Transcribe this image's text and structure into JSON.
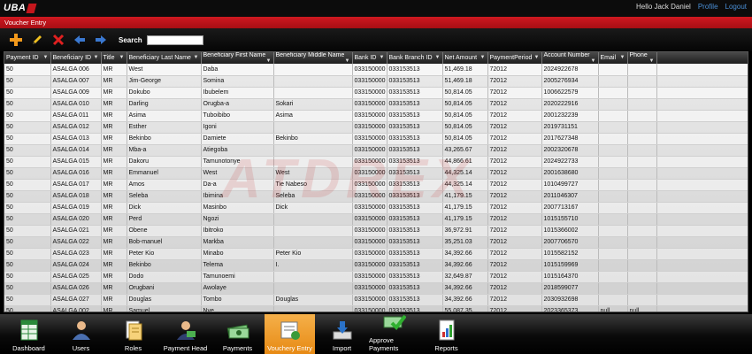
{
  "topbar": {
    "logo": "UBA",
    "greeting": "Hello Jack Daniel",
    "profile": "Profile",
    "logout": "Logout"
  },
  "titlebar": {
    "title": "Voucher Entry"
  },
  "toolbar": {
    "search_label": "Search",
    "search_value": ""
  },
  "watermark": "ATDREX",
  "table": {
    "columns": [
      "Payment ID",
      "Beneficiary ID",
      "Title",
      "Beneficiary Last Name",
      "Beneficiary First Name",
      "Beneficiary Middle Name",
      "Bank ID",
      "Bank Branch ID",
      "Net Amount",
      "PaymentPeriod",
      "Account Number",
      "Email",
      "Phone"
    ],
    "rows": [
      [
        "50",
        "ASALGA 006",
        "MR",
        "West",
        "Daba",
        "",
        "033150000",
        "033153513",
        "51,469.18",
        "72012",
        "2024922678",
        "",
        ""
      ],
      [
        "50",
        "ASALGA 007",
        "MR",
        "Jim-George",
        "Somina",
        "",
        "033150000",
        "033153513",
        "51,469.18",
        "72012",
        "2005276934",
        "",
        ""
      ],
      [
        "50",
        "ASALGA 009",
        "MR",
        "Dokubo",
        "Ibubelem",
        "",
        "033150000",
        "033153513",
        "50,814.05",
        "72012",
        "1006622579",
        "",
        ""
      ],
      [
        "50",
        "ASALGA 010",
        "MR",
        "Darling",
        "Orugba-a",
        "Sokari",
        "033150000",
        "033153513",
        "50,814.05",
        "72012",
        "2020222916",
        "",
        ""
      ],
      [
        "50",
        "ASALGA 011",
        "MR",
        "Asima",
        "Tuboibibo",
        "Asima",
        "033150000",
        "033153513",
        "50,814.05",
        "72012",
        "2001232239",
        "",
        ""
      ],
      [
        "50",
        "ASALGA 012",
        "MR",
        "Esther",
        "Igoni",
        "",
        "033150000",
        "033153513",
        "50,814.05",
        "72012",
        "2019731151",
        "",
        ""
      ],
      [
        "50",
        "ASALGA 013",
        "MR",
        "Bekinbo",
        "Damiete",
        "Bekinbo",
        "033150000",
        "033153513",
        "50,814.05",
        "72012",
        "2017627348",
        "",
        ""
      ],
      [
        "50",
        "ASALGA 014",
        "MR",
        "Mba-a",
        "Atiegoba",
        "",
        "033150000",
        "033153513",
        "43,265.67",
        "72012",
        "2002320678",
        "",
        ""
      ],
      [
        "50",
        "ASALGA 015",
        "MR",
        "Dakoru",
        "Tamunotonye",
        "",
        "033150000",
        "033153513",
        "44,866.61",
        "72012",
        "2024922733",
        "",
        ""
      ],
      [
        "50",
        "ASALGA 016",
        "MR",
        "Emmanuel",
        "West",
        "West",
        "033150000",
        "033153513",
        "44,325.14",
        "72012",
        "2001638680",
        "",
        ""
      ],
      [
        "50",
        "ASALGA 017",
        "MR",
        "Amos",
        "Da-a",
        "Tie Nabeso",
        "033150000",
        "033153513",
        "44,325.14",
        "72012",
        "1010499727",
        "",
        ""
      ],
      [
        "50",
        "ASALGA 018",
        "MR",
        "Seleba",
        "Ibimina",
        "Seleba",
        "033150000",
        "033153513",
        "41,179.15",
        "72012",
        "2011046307",
        "",
        ""
      ],
      [
        "50",
        "ASALGA 019",
        "MR",
        "Dick",
        "Masinbo",
        "Dick",
        "033150000",
        "033153513",
        "41,179.15",
        "72012",
        "2007713167",
        "",
        ""
      ],
      [
        "50",
        "ASALGA 020",
        "MR",
        "Perd",
        "Ngozi",
        "",
        "033150000",
        "033153513",
        "41,179.15",
        "72012",
        "1015155710",
        "",
        ""
      ],
      [
        "50",
        "ASALGA 021",
        "MR",
        "Obene",
        "Ibitroko",
        "",
        "033150000",
        "033153513",
        "36,972.91",
        "72012",
        "1015366002",
        "",
        ""
      ],
      [
        "50",
        "ASALGA 022",
        "MR",
        "Bob-manuel",
        "Markba",
        "",
        "033150000",
        "033153513",
        "35,251.03",
        "72012",
        "2007706570",
        "",
        ""
      ],
      [
        "50",
        "ASALGA 023",
        "MR",
        "Peter Kio",
        "Minabo",
        "Peter Kio",
        "033150000",
        "033153513",
        "34,392.66",
        "72012",
        "1015582152",
        "",
        ""
      ],
      [
        "50",
        "ASALGA 024",
        "MR",
        "Bekinbo",
        "Telema",
        "I.",
        "033150000",
        "033153513",
        "34,392.66",
        "72012",
        "1015159969",
        "",
        ""
      ],
      [
        "50",
        "ASALGA 025",
        "MR",
        "Dodo",
        "Tamunoemi",
        "",
        "033150000",
        "033153513",
        "32,649.87",
        "72012",
        "1015164370",
        "",
        ""
      ],
      [
        "50",
        "ASALGA 026",
        "MR",
        "Orugbani",
        "Awolaye",
        "",
        "033150000",
        "033153513",
        "34,392.66",
        "72012",
        "2018599077",
        "",
        ""
      ],
      [
        "50",
        "ASALGA 027",
        "MR",
        "Douglas",
        "Tombo",
        "Douglas",
        "033150000",
        "033153513",
        "34,392.66",
        "72012",
        "2030932698",
        "",
        ""
      ],
      [
        "50",
        "ASALGA 002",
        "MR",
        "Samuel",
        "Nye",
        "",
        "033150000",
        "033153513",
        "55,087.35",
        "72012",
        "2023365373",
        "null",
        "null"
      ]
    ]
  },
  "nav": [
    {
      "label": "Dashboard",
      "icon": "spreadsheet-icon"
    },
    {
      "label": "Users",
      "icon": "user-icon"
    },
    {
      "label": "Roles",
      "icon": "roles-icon"
    },
    {
      "label": "Payment Head",
      "icon": "payment-head-icon"
    },
    {
      "label": "Payments",
      "icon": "money-icon"
    },
    {
      "label": "Vouchery Entry",
      "icon": "voucher-icon",
      "active": true
    },
    {
      "label": "Import",
      "icon": "import-icon"
    },
    {
      "label": "Approve Payments",
      "icon": "approve-icon"
    },
    {
      "label": "Reports",
      "icon": "reports-icon"
    }
  ],
  "colors": {
    "accent": "#c4161c",
    "active_tab": "#f0a030",
    "link": "#4a8fd6"
  }
}
